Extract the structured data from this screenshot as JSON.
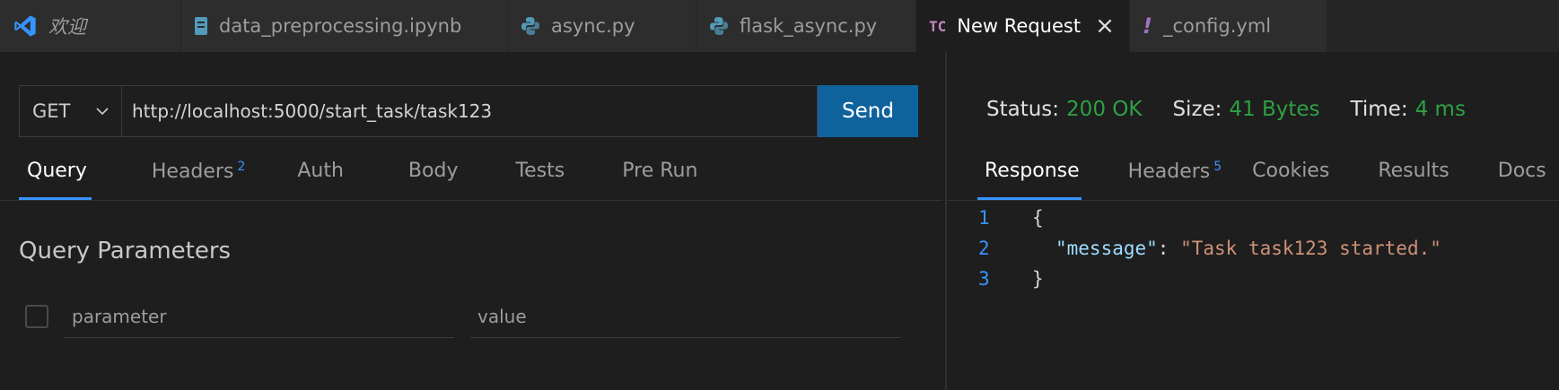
{
  "tabs": [
    {
      "label": "欢迎",
      "icon": "vscode-logo-icon"
    },
    {
      "label": "data_preprocessing.ipynb",
      "icon": "notebook-icon"
    },
    {
      "label": "async.py",
      "icon": "python-icon"
    },
    {
      "label": "flask_async.py",
      "icon": "python-icon"
    },
    {
      "label": "New Request",
      "icon": "thunder-client-icon",
      "icon_text": "TC",
      "active": true
    },
    {
      "label": "_config.yml",
      "icon": "yaml-icon",
      "icon_text": "!"
    }
  ],
  "request": {
    "method": "GET",
    "url": "http://localhost:5000/start_task/task123",
    "send_label": "Send",
    "tabs": [
      {
        "label": "Query",
        "active": true
      },
      {
        "label": "Headers",
        "badge": "2"
      },
      {
        "label": "Auth"
      },
      {
        "label": "Body"
      },
      {
        "label": "Tests"
      },
      {
        "label": "Pre Run"
      }
    ],
    "query_title": "Query Parameters",
    "param_placeholder": "parameter",
    "value_placeholder": "value"
  },
  "response": {
    "status_label": "Status:",
    "status_value": "200 OK",
    "size_label": "Size:",
    "size_value": "41 Bytes",
    "time_label": "Time:",
    "time_value": "4 ms",
    "tabs": [
      {
        "label": "Response",
        "active": true
      },
      {
        "label": "Headers",
        "badge": "5"
      },
      {
        "label": "Cookies"
      },
      {
        "label": "Results"
      },
      {
        "label": "Docs"
      }
    ],
    "lines": [
      {
        "num": "1",
        "open": "{"
      },
      {
        "num": "2",
        "key": "\"message\"",
        "colon": ": ",
        "value": "\"Task task123 started.\""
      },
      {
        "num": "3",
        "close": "}"
      }
    ]
  },
  "colors": {
    "accent": "#3794ff",
    "send_button": "#0e639c",
    "success": "#2ea043",
    "json_key": "#9cdcfe",
    "json_string": "#ce9178"
  }
}
